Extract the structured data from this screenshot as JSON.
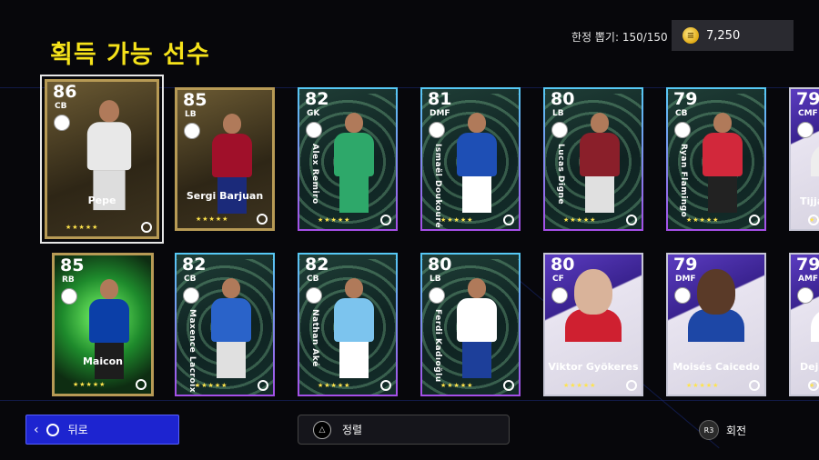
{
  "header": {
    "title": "획득 가능 선수",
    "draw_count": "한정 뽑기: 150/150",
    "coins": "7,250"
  },
  "cards": [
    {
      "rating": "86",
      "pos": "CB",
      "name": "Pepe",
      "name_style": "horizontal",
      "style": "gold"
    },
    {
      "rating": "85",
      "pos": "LB",
      "name": "Sergi Barjuan",
      "name_style": "horizontal",
      "style": "gold"
    },
    {
      "rating": "82",
      "pos": "GK",
      "name": "Alex Remiro",
      "name_style": "vertical",
      "style": "std"
    },
    {
      "rating": "81",
      "pos": "DMF",
      "name": "Ismaël Doukouré",
      "name_style": "vertical",
      "style": "std"
    },
    {
      "rating": "80",
      "pos": "LB",
      "name": "Lucas Digne",
      "name_style": "vertical",
      "style": "std"
    },
    {
      "rating": "79",
      "pos": "CB",
      "name": "Ryan Flamingo",
      "name_style": "vertical",
      "style": "std"
    },
    {
      "rating": "79",
      "pos": "CMF",
      "name": "Tijja",
      "name_style": "horizontal",
      "style": "purple"
    },
    {
      "rating": "85",
      "pos": "RB",
      "name": "Maicon",
      "name_style": "horizontal",
      "style": "epic-green"
    },
    {
      "rating": "82",
      "pos": "CB",
      "name": "Maxence Lacroix",
      "name_style": "vertical",
      "style": "std"
    },
    {
      "rating": "82",
      "pos": "CB",
      "name": "Nathan Aké",
      "name_style": "vertical",
      "style": "std"
    },
    {
      "rating": "80",
      "pos": "LB",
      "name": "Ferdi Kadıoğlu",
      "name_style": "vertical",
      "style": "std"
    },
    {
      "rating": "80",
      "pos": "CF",
      "name": "Viktor Gyökeres",
      "name_style": "horizontal",
      "style": "purple"
    },
    {
      "rating": "79",
      "pos": "DMF",
      "name": "Moisés Caicedo",
      "name_style": "horizontal",
      "style": "purple"
    },
    {
      "rating": "79",
      "pos": "AMF",
      "name": "Deja",
      "name_style": "horizontal",
      "style": "purple"
    }
  ],
  "footer": {
    "back_label": "뒤로",
    "sort_label": "정렬",
    "rotate_label": "회전",
    "rotate_button": "R3",
    "sort_button": "△"
  },
  "colors": {
    "title": "#f5e21a",
    "back_button": "#1d24d0",
    "stars": "#ffe44c"
  }
}
